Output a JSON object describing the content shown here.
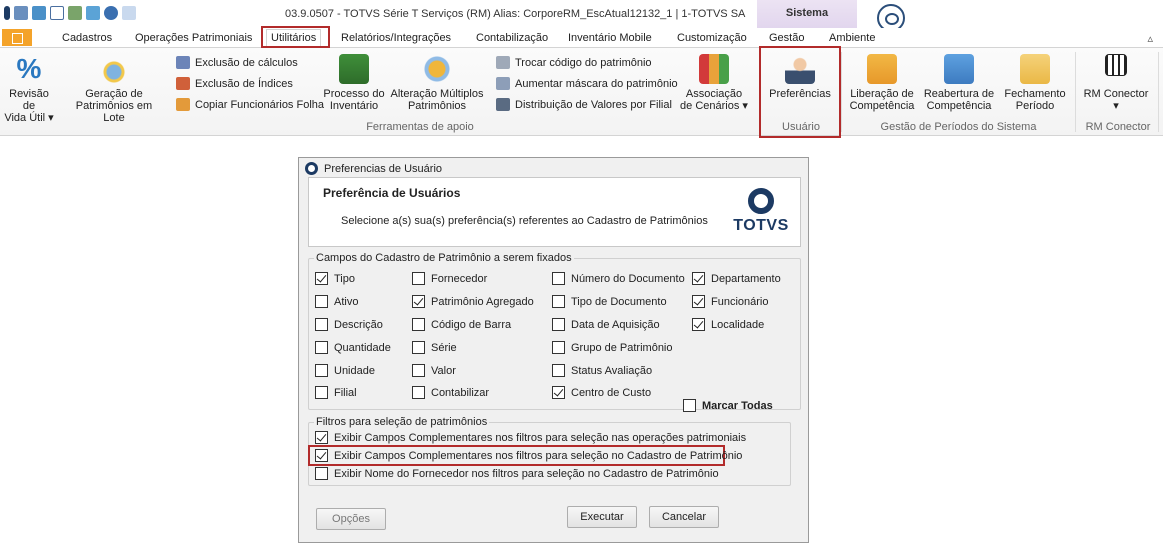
{
  "titlebar": {
    "title": "03.9.0507 - TOTVS Série T Serviços (RM) Alias: CorporeRM_EscAtual12132_1 | 1-TOTVS SA",
    "context_tab": "Sistema"
  },
  "menu": {
    "tabs": [
      "Cadastros",
      "Operações Patrimoniais",
      "Utilitários",
      "Relatórios/Integrações",
      "Contabilização",
      "Inventário Mobile",
      "Customização",
      "Gestão",
      "Ambiente"
    ],
    "collapse_glyph": "▵"
  },
  "ribbon": {
    "revisao": [
      "Revisão de",
      "Vida Útil ▾"
    ],
    "geracao": [
      "Geração de",
      "Patrimônios em Lote"
    ],
    "exclusao_calculos": "Exclusão de cálculos",
    "exclusao_indices": "Exclusão de Índices",
    "copiar_funcionarios": "Copiar Funcionários Folha",
    "processo": [
      "Processo do",
      "Inventário"
    ],
    "alteracao": [
      "Alteração Múltiplos",
      "Patrimônios"
    ],
    "trocar_codigo": "Trocar código do patrimônio",
    "aumentar_mascara": "Aumentar máscara do patrimônio",
    "distribuicao": "Distribuição de Valores por Filial",
    "associacao": [
      "Associação",
      "de Cenários ▾"
    ],
    "preferencias": "Preferências",
    "liberacao": [
      "Liberação de",
      "Competência"
    ],
    "reabertura": [
      "Reabertura de",
      "Competência"
    ],
    "fechamento": [
      "Fechamento",
      "Período"
    ],
    "rm_conector": [
      "RM Conector",
      "▾"
    ],
    "groups": {
      "ferramentas": "Ferramentas de apoio",
      "usuario": "Usuário",
      "gestao": "Gestão de Períodos do Sistema",
      "rm_conector": "RM Conector"
    }
  },
  "dialog": {
    "title": "Preferencias de Usuário",
    "header_title": "Preferência de Usuários",
    "header_subtitle": "Selecione a(s) sua(s) preferência(s) referentes ao Cadastro de Patrimônios",
    "logo_text": "TOTVS",
    "campos_legend": "Campos do Cadastro de Patrimônio a serem fixados",
    "campos": [
      {
        "label": "Tipo",
        "checked": true
      },
      {
        "label": "Ativo",
        "checked": false
      },
      {
        "label": "Descrição",
        "checked": false
      },
      {
        "label": "Quantidade",
        "checked": false
      },
      {
        "label": "Unidade",
        "checked": false
      },
      {
        "label": "Filial",
        "checked": false
      },
      {
        "label": "Fornecedor",
        "checked": false
      },
      {
        "label": "Patrimônio Agregado",
        "checked": true
      },
      {
        "label": "Código de Barra",
        "checked": false
      },
      {
        "label": "Série",
        "checked": false
      },
      {
        "label": "Valor",
        "checked": false
      },
      {
        "label": "Contabilizar",
        "checked": false
      },
      {
        "label": "Número do Documento",
        "checked": false
      },
      {
        "label": "Tipo de Documento",
        "checked": false
      },
      {
        "label": "Data de Aquisição",
        "checked": false
      },
      {
        "label": "Grupo de Patrimônio",
        "checked": false
      },
      {
        "label": "Status Avaliação",
        "checked": false
      },
      {
        "label": "Centro de Custo",
        "checked": true
      },
      {
        "label": "Departamento",
        "checked": true
      },
      {
        "label": "Funcionário",
        "checked": true
      },
      {
        "label": "Localidade",
        "checked": true
      }
    ],
    "marcar_todas": "Marcar Todas",
    "filtros_legend": "Filtros para seleção de patrimônios",
    "filtros": [
      {
        "label": "Exibir Campos Complementares nos filtros para seleção nas operações patrimoniais",
        "checked": true
      },
      {
        "label": "Exibir Campos Complementares nos filtros para seleção no Cadastro de Patrimônio",
        "checked": true
      },
      {
        "label": "Exibir Nome do Fornecedor nos filtros para seleção no Cadastro de Patrimônio",
        "checked": false
      }
    ],
    "buttons": {
      "opcoes": "Opções",
      "executar": "Executar",
      "cancelar": "Cancelar"
    }
  },
  "colors": {
    "accent": "#b22b2b",
    "brand": "#1c3a63",
    "file_tab": "#f4a32a"
  }
}
